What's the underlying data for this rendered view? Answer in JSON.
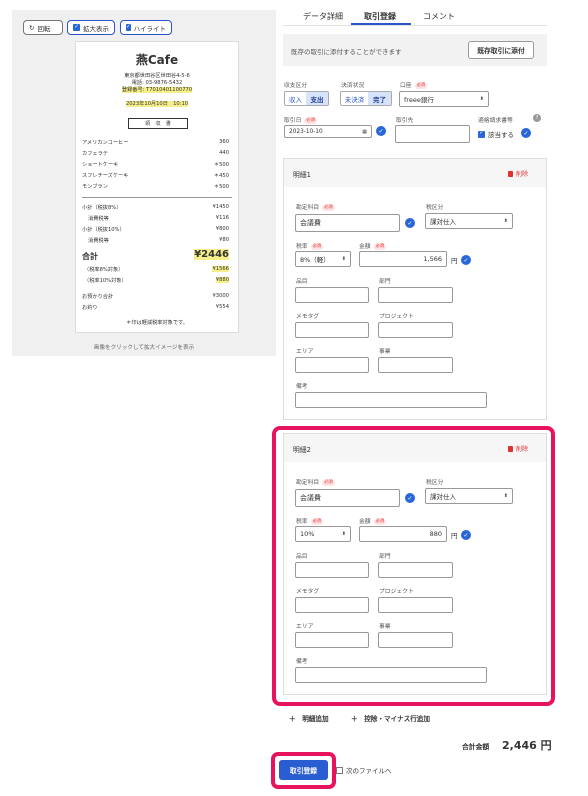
{
  "toolbar": {
    "rotate_label": "回転",
    "zoom_label": "拡大表示",
    "highlight_label": "ハイライト"
  },
  "receipt": {
    "store_name": "燕Cafe",
    "address": "東京都世田谷区世田谷4-5-6",
    "phone": "電話: 03-9876-5432",
    "reg_no": "登録番号: T7010401100770",
    "date": "2023年10月10日　10:10",
    "title": "領　収　書",
    "items": [
      {
        "name": "アメリカンコーヒー",
        "price": "360"
      },
      {
        "name": "カフェラテ",
        "price": "440"
      },
      {
        "name": "ショートケーキ",
        "price": "＊500"
      },
      {
        "name": "スフレチーズケーキ",
        "price": "＊450"
      },
      {
        "name": "モンブラン",
        "price": "＊500"
      }
    ],
    "subtotal8_label": "小計（税抜8%）",
    "subtotal8": "¥1450",
    "tax8_label": "消費税等",
    "tax8": "¥116",
    "subtotal10_label": "小計（税抜10%）",
    "subtotal10": "¥800",
    "tax10_label": "消費税等",
    "tax10": "¥80",
    "total_label": "合計",
    "total": "¥2446",
    "target8_label": "（税率8%対象）",
    "target8": "¥1566",
    "target10_label": "（税率10%対象）",
    "target10": "¥880",
    "received_label": "お預かり合計",
    "received": "¥3000",
    "change_label": "お釣り",
    "change": "¥554",
    "note": "＊印は軽減税率対象です。",
    "caption": "画像をクリックして拡大イメージを表示"
  },
  "tabs": [
    {
      "label": "データ詳細"
    },
    {
      "label": "取引登録"
    },
    {
      "label": "コメント"
    }
  ],
  "attach": {
    "text": "既存の取引に添付することができます",
    "button": "既存取引に添付"
  },
  "form": {
    "required": "必須",
    "income_label": "収支区分",
    "income_options": [
      "収入",
      "支出"
    ],
    "settle_label": "決済状況",
    "settle_options": [
      "未決済",
      "完了"
    ],
    "account_label": "口座",
    "account_value": "freee銀行",
    "date_label": "取引日",
    "date_value": "2023-10-10",
    "partner_label": "取引先",
    "partner_value": "",
    "qualified_label": "適格請求書等",
    "qualified_check_label": "該当する"
  },
  "details": [
    {
      "title": "明細1",
      "delete_label": "削除",
      "account_item_label": "勘定科目",
      "account_item_value": "会議費",
      "tax_category_label": "税区分",
      "tax_category_value": "課対仕入",
      "tax_rate_label": "税率",
      "tax_rate_value": "8%（軽）",
      "amount_label": "金額",
      "amount_value": "1,566",
      "yen": "円",
      "item_label": "品目",
      "dept_label": "部門",
      "memo_label": "メモタグ",
      "project_label": "プロジェクト",
      "area_label": "エリア",
      "business_label": "事業",
      "note_label": "備考"
    },
    {
      "title": "明細2",
      "delete_label": "削除",
      "account_item_label": "勘定科目",
      "account_item_value": "会議費",
      "tax_category_label": "税区分",
      "tax_category_value": "課対仕入",
      "tax_rate_label": "税率",
      "tax_rate_value": "10%",
      "amount_label": "金額",
      "amount_value": "880",
      "yen": "円",
      "item_label": "品目",
      "dept_label": "部門",
      "memo_label": "メモタグ",
      "project_label": "プロジェクト",
      "area_label": "エリア",
      "business_label": "事業",
      "note_label": "備考"
    }
  ],
  "actions": {
    "add_detail": "明細追加",
    "add_deduction": "控除・マイナス行追加",
    "total_label": "合計金額",
    "total_value": "2,446 円",
    "submit": "取引登録",
    "next_file": "次のファイルへ"
  },
  "colors": {
    "accent": "#2a55c9",
    "highlight_ring": "#e8135e",
    "required_bg": "#fde3e3",
    "receipt_highlight": "#f6ef8a"
  }
}
